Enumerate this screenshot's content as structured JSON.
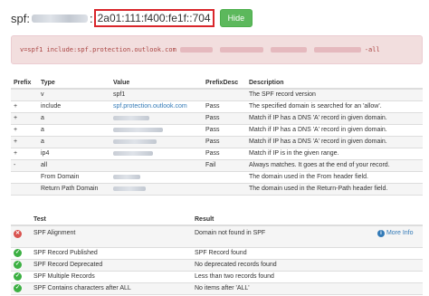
{
  "header": {
    "title": "spf:",
    "separator": ":",
    "ip": "2a01:111:f400:fe1f::704",
    "hide_label": "Hide"
  },
  "record": {
    "prefix": "v=spf1 include:spf.protection.outlook.com",
    "suffix": "-all"
  },
  "spf_table": {
    "columns": [
      "Prefix",
      "Type",
      "Value",
      "PrefixDesc",
      "Description"
    ],
    "rows": [
      {
        "prefix": "",
        "type": "v",
        "value": "spf1",
        "pdesc": "",
        "desc": "The SPF record version"
      },
      {
        "prefix": "+",
        "type": "include",
        "value": "spf.protection.outlook.com",
        "pdesc": "Pass",
        "desc": "The specified domain is searched for an 'allow'."
      },
      {
        "prefix": "+",
        "type": "a",
        "value": "",
        "pdesc": "Pass",
        "desc": "Match if IP has a DNS 'A' record in given domain."
      },
      {
        "prefix": "+",
        "type": "a",
        "value": "",
        "pdesc": "Pass",
        "desc": "Match if IP has a DNS 'A' record in given domain."
      },
      {
        "prefix": "+",
        "type": "a",
        "value": "",
        "pdesc": "Pass",
        "desc": "Match if IP has a DNS 'A' record in given domain."
      },
      {
        "prefix": "+",
        "type": "ip4",
        "value": "",
        "pdesc": "Pass",
        "desc": "Match if IP is in the given range."
      },
      {
        "prefix": "-",
        "type": "all",
        "value": "",
        "pdesc": "Fail",
        "desc": "Always matches. It goes at the end of your record."
      },
      {
        "prefix": "",
        "type": "From Domain",
        "value": "",
        "pdesc": "",
        "desc": "The domain used in the From header field."
      },
      {
        "prefix": "",
        "type": "Return Path Domain",
        "value": "",
        "pdesc": "",
        "desc": "The domain used in the Return-Path header field."
      }
    ]
  },
  "test_table": {
    "columns": [
      "",
      "Test",
      "Result",
      ""
    ],
    "more_info": "More Info",
    "rows": [
      {
        "status": "error",
        "test": "SPF Alignment",
        "result": "Domain not found in SPF"
      },
      {
        "status": "ok",
        "test": "SPF Record Published",
        "result": "SPF Record found"
      },
      {
        "status": "ok",
        "test": "SPF Record Deprecated",
        "result": "No deprecated records found"
      },
      {
        "status": "ok",
        "test": "SPF Multiple Records",
        "result": "Less than two records found"
      },
      {
        "status": "ok",
        "test": "SPF Contains characters after ALL",
        "result": "No items after 'ALL'"
      }
    ]
  },
  "colors": {
    "ok": "#3cb043",
    "error": "#d9534f",
    "accent": "#337ab7",
    "ip_highlight": "#d9262b"
  }
}
